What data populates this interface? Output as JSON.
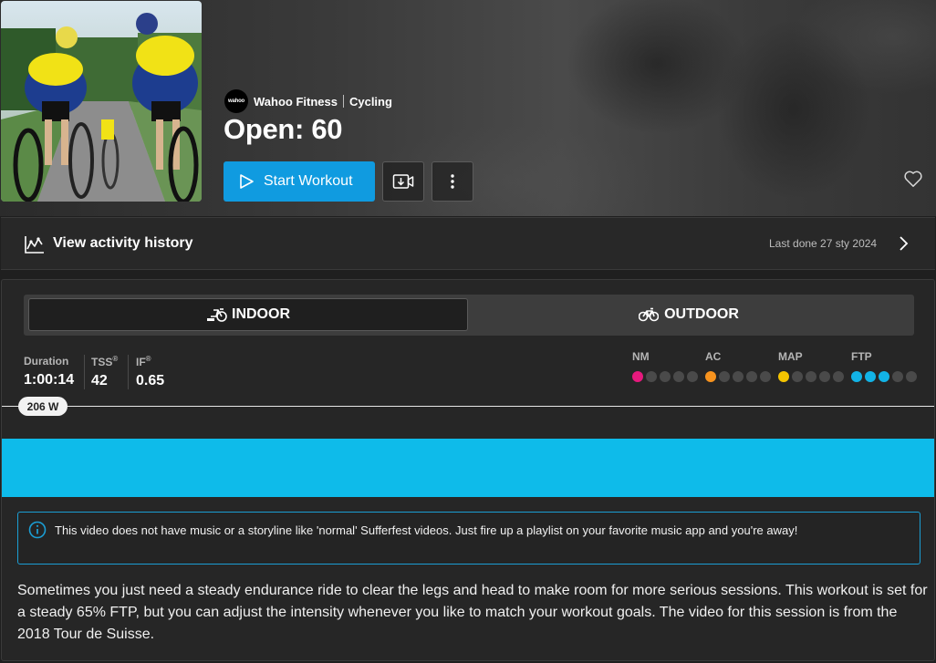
{
  "workout": {
    "provider": "Wahoo Fitness",
    "provider_logo_text": "wahoo",
    "category": "Cycling",
    "title": "Open: 60",
    "start_label": "Start Workout"
  },
  "history": {
    "label": "View activity history",
    "last_done": "Last done 27 sty 2024"
  },
  "modes": {
    "indoor": "INDOOR",
    "outdoor": "OUTDOOR",
    "selected": "INDOOR"
  },
  "metrics": [
    {
      "label": "Duration",
      "value": "1:00:14"
    },
    {
      "label": "TSS",
      "sup": "®",
      "value": "42"
    },
    {
      "label": "IF",
      "sup": "®",
      "value": "0.65"
    }
  ],
  "zones": [
    {
      "label": "NM",
      "level": 1,
      "color": "#e6197d"
    },
    {
      "label": "AC",
      "level": 1,
      "color": "#f7931e"
    },
    {
      "label": "MAP",
      "level": 1,
      "color": "#f5c400"
    },
    {
      "label": "FTP",
      "level": 3,
      "color": "#12b3e6"
    }
  ],
  "graph": {
    "ftp_label": "206 W",
    "bar_color": "#0ebbea"
  },
  "info": {
    "text": "This video does not have music or a storyline like 'normal' Sufferfest videos. Just fire up a playlist on your favorite music app and you're away!"
  },
  "description": "Sometimes you just need a steady endurance ride to clear the legs and head to make room for more serious sessions. This workout is set for a steady 65% FTP, but you can adjust the intensity whenever you like to match your workout goals. The video for this session is from the 2018 Tour de Suisse.",
  "icons": {
    "play": "play-outline-icon",
    "video_download": "video-download-icon",
    "more": "more-vertical-icon",
    "favorite": "heart-outline-icon",
    "history": "activity-chart-icon",
    "chevron": "chevron-right-icon",
    "indoor": "indoor-trainer-icon",
    "outdoor": "bike-icon",
    "info": "info-circle-icon"
  }
}
